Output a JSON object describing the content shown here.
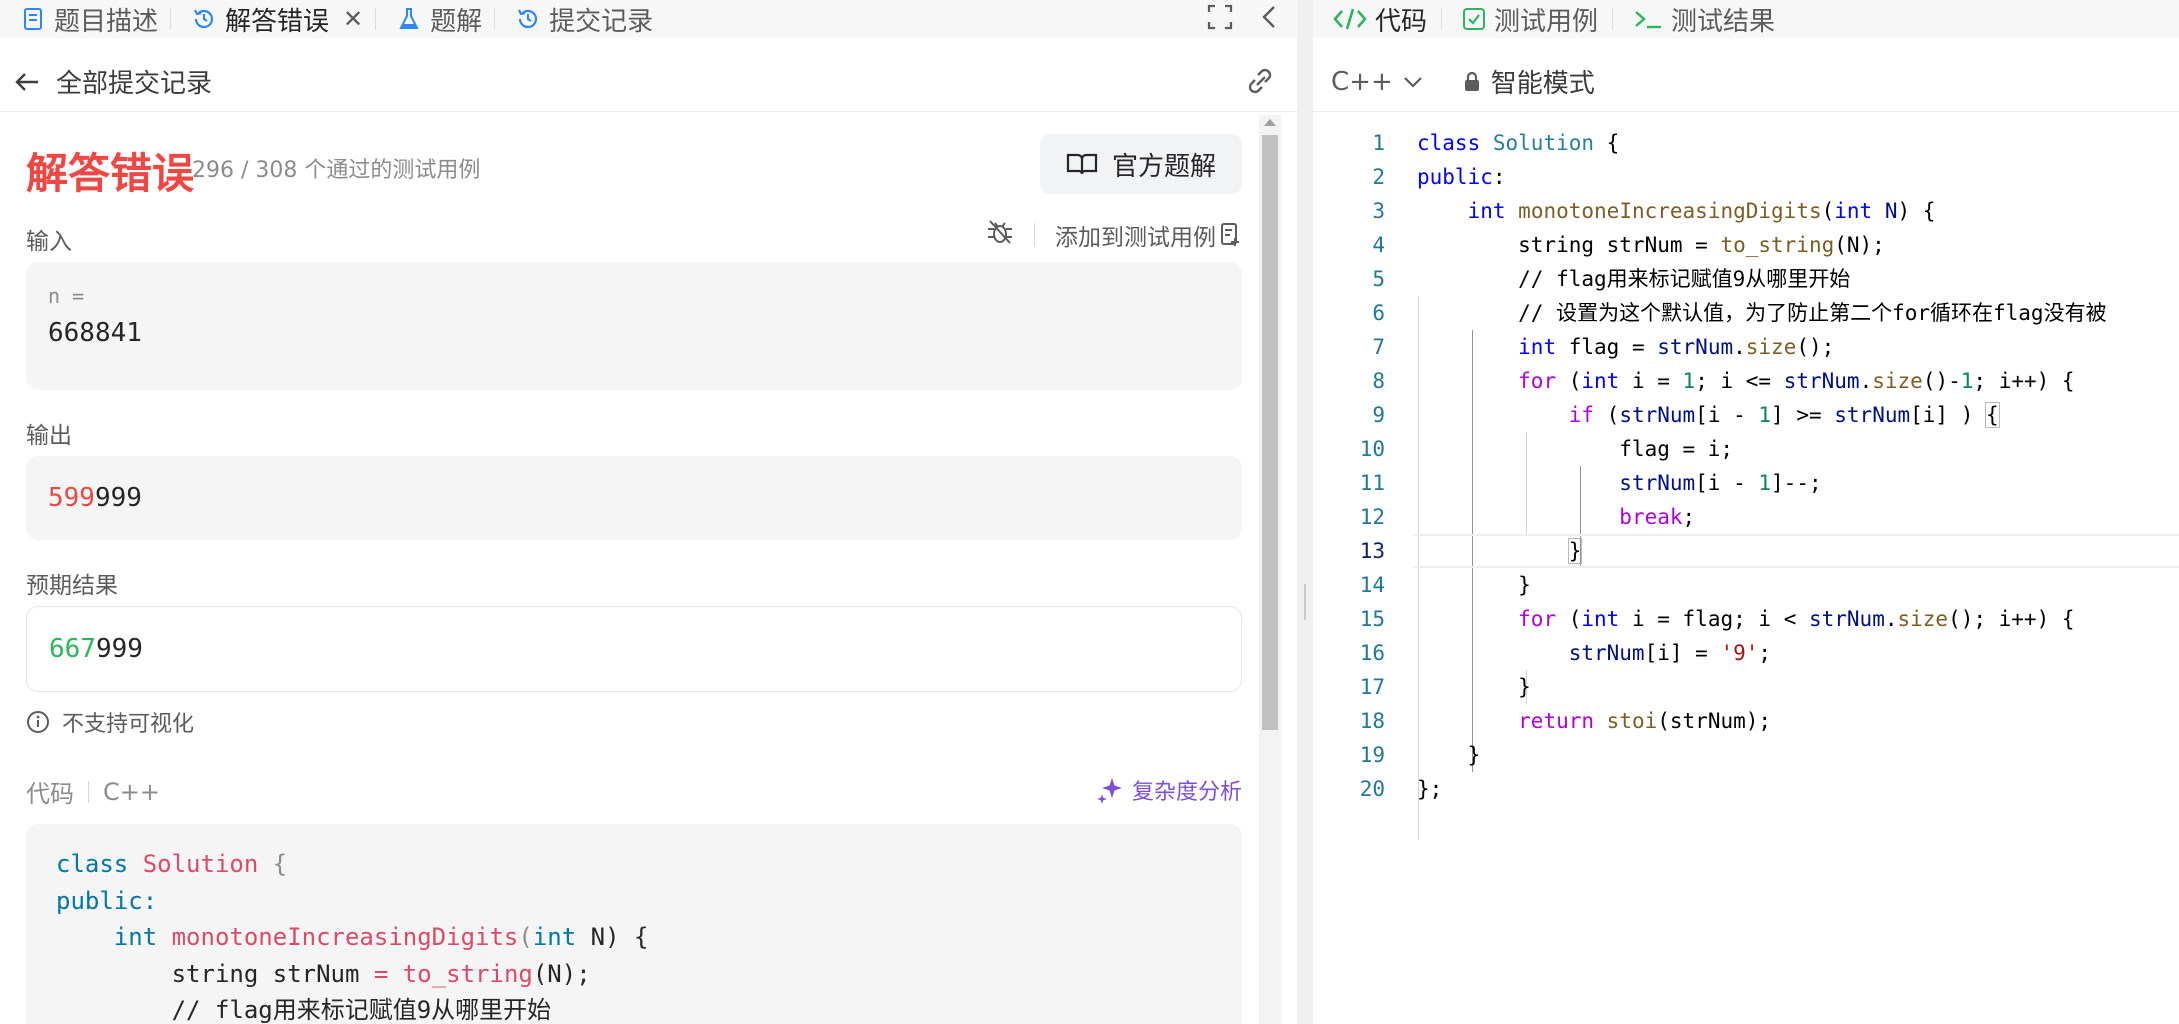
{
  "left_tabs": [
    {
      "label": "题目描述",
      "icon": "doc-icon"
    },
    {
      "label": "解答错误",
      "icon": "history-icon",
      "active": true,
      "closable": true
    },
    {
      "label": "题解",
      "icon": "flask-icon"
    },
    {
      "label": "提交记录",
      "icon": "history-icon"
    }
  ],
  "subheader": {
    "title": "全部提交记录"
  },
  "result": {
    "title": "解答错误",
    "passed": "296 / 308 个通过的测试用例",
    "official_button": "官方题解"
  },
  "input": {
    "label": "输入",
    "add_to_testcase": "添加到测试用例",
    "var_name": "n =",
    "value": "668841"
  },
  "output": {
    "label": "输出",
    "diff_part": "599",
    "same_part": "999"
  },
  "expected": {
    "label": "预期结果",
    "diff_part": "667",
    "same_part": "999"
  },
  "no_visualization": "不支持可视化",
  "code_section": {
    "label": "代码",
    "language": "C++",
    "complexity_button": "复杂度分析",
    "lines": [
      [
        "class ",
        "Solution",
        " {"
      ],
      [
        "public:",
        "",
        ""
      ],
      [
        "    int ",
        "monotoneIncreasingDigits",
        "(",
        "int",
        " N) {"
      ],
      [
        "        string strNum ",
        "=",
        " ",
        "to_string",
        "(N);"
      ],
      [
        "        // flag用来标记赋值9从哪里开始"
      ]
    ]
  },
  "right_tabs": [
    {
      "label": "代码",
      "icon": "code-icon",
      "active": true
    },
    {
      "label": "测试用例",
      "icon": "checkbox-icon"
    },
    {
      "label": "测试结果",
      "icon": "terminal-icon"
    }
  ],
  "editor_toolbar": {
    "language": "C++",
    "mode": "智能模式"
  },
  "editor": {
    "current_line": 13,
    "line_numbers": [
      "1",
      "2",
      "3",
      "4",
      "5",
      "6",
      "7",
      "8",
      "9",
      "10",
      "11",
      "12",
      "13",
      "14",
      "15",
      "16",
      "17",
      "18",
      "19",
      "20"
    ],
    "lines": [
      "class Solution {",
      "public:",
      "    int monotoneIncreasingDigits(int N) {",
      "        string strNum = to_string(N);",
      "        // flag用来标记赋值9从哪里开始",
      "        // 设置为这个默认值，为了防止第二个for循环在flag没有被",
      "        int flag = strNum.size();",
      "        for (int i = 1; i <= strNum.size()-1; i++) {",
      "            if (strNum[i - 1] >= strNum[i] ) {",
      "                flag = i;",
      "                strNum[i - 1]--;",
      "                break;",
      "            }",
      "        }",
      "        for (int i = flag; i < strNum.size(); i++) {",
      "            strNum[i] = '9';",
      "        }",
      "        return stoi(strNum);",
      "    }",
      "};"
    ]
  },
  "colors": {
    "error_red": "#ef4743",
    "success_green": "#2db55d",
    "accent_purple": "#7e4fd6"
  }
}
